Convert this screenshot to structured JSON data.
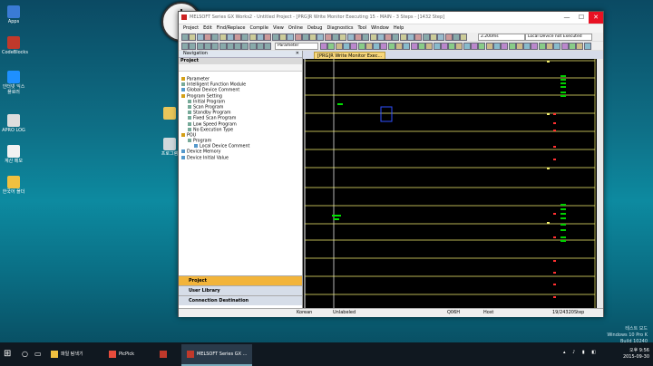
{
  "desktop": {
    "icons": [
      {
        "label": "Apps",
        "color": "#3a7bd5"
      },
      {
        "label": "CodeBlocks",
        "color": "#c0392b"
      },
      {
        "label": "인터넷 익스플로러",
        "color": "#1e90ff"
      },
      {
        "label": "APRO LOG",
        "color": "#dddddd"
      },
      {
        "label": "계산 메모",
        "color": "#f2f2f2"
      },
      {
        "label": "한국어 폴더",
        "color": "#f0c040"
      }
    ],
    "right_icons": [
      {
        "label": "",
        "color": "#e8c65a"
      },
      {
        "label": "프로그램",
        "color": "#cfd8dc"
      }
    ],
    "watermark": {
      "line1": "테스트 모드",
      "line2": "Windows 10 Pro K",
      "line3": "Build 10240"
    }
  },
  "window": {
    "title": "MELSOFT Series GX Works2 - Untitled Project - [PRG]R Write Monitor Executing 15 - MAIN - 3 Steps - [1432 Step]",
    "controls": {
      "minimize": "—",
      "maximize": "☐",
      "close": "✕"
    },
    "menu": [
      "Project",
      "Edit",
      "Find/Replace",
      "Compile",
      "View",
      "Online",
      "Debug",
      "Diagnostics",
      "Tool",
      "Window",
      "Help"
    ],
    "toolbar": {
      "parameter_field": "Parameter",
      "scan_time": "2.200ms",
      "device_status": "Local Device not Executed"
    },
    "navigation": {
      "header": "Navigation",
      "project_header": "Project",
      "tree": [
        {
          "label": "Parameter",
          "level": 0,
          "color": "#d4a017"
        },
        {
          "label": "Intelligent Function Module",
          "level": 0,
          "color": "#7a9"
        },
        {
          "label": "Global Device Comment",
          "level": 0,
          "color": "#59c"
        },
        {
          "label": "Program Setting",
          "level": 0,
          "color": "#d4a017"
        },
        {
          "label": "Initial Program",
          "level": 1,
          "color": "#7a9"
        },
        {
          "label": "Scan Program",
          "level": 1,
          "color": "#7a9"
        },
        {
          "label": "Standby Program",
          "level": 1,
          "color": "#7a9"
        },
        {
          "label": "Fixed Scan Program",
          "level": 1,
          "color": "#7a9"
        },
        {
          "label": "Low Speed Program",
          "level": 1,
          "color": "#7a9"
        },
        {
          "label": "No Execution Type",
          "level": 1,
          "color": "#7a9"
        },
        {
          "label": "POU",
          "level": 0,
          "color": "#d4a017"
        },
        {
          "label": "Program",
          "level": 1,
          "color": "#7a9"
        },
        {
          "label": "Local Device Comment",
          "level": 2,
          "color": "#59c"
        },
        {
          "label": "Device Memory",
          "level": 0,
          "color": "#59c"
        },
        {
          "label": "Device Initial Value",
          "level": 0,
          "color": "#59c"
        }
      ],
      "buttons": [
        "Project",
        "User Library",
        "Connection Destination"
      ]
    },
    "editor": {
      "tab": "[PRG]R Write Monitor Exec..."
    },
    "status": {
      "language": "Korean",
      "label_state": "Unlabeled",
      "module": "Q06H",
      "host": "Host",
      "steps": "19/24320Step"
    }
  },
  "taskbar": {
    "items": [
      {
        "label": "파일 탐색기",
        "color": "#f0c040"
      },
      {
        "label": "PicPick",
        "color": "#e74c3c"
      },
      {
        "label": "",
        "color": "#c0392b"
      },
      {
        "label": "MELSOFT Series GX ...",
        "color": "#c0392b"
      }
    ],
    "time": "오후 9:56",
    "date": "2015-09-30"
  }
}
